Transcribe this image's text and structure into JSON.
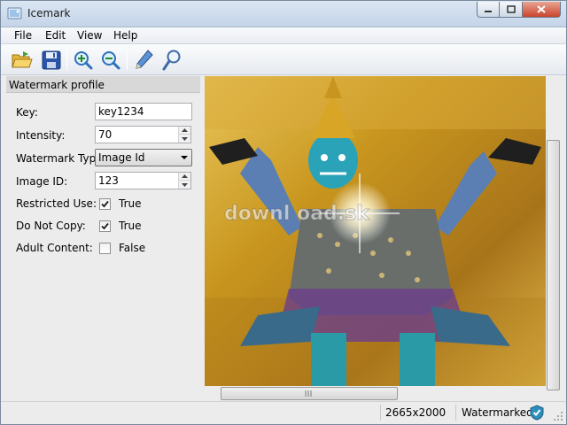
{
  "window": {
    "title": "Icemark"
  },
  "menu": [
    "File",
    "Edit",
    "View",
    "Help"
  ],
  "toolbar": {
    "open": "open-folder-icon",
    "save": "save-disk-icon",
    "zoom_in": "zoom-in-icon",
    "zoom_out": "zoom-out-icon",
    "pen": "pencil-icon",
    "detect": "magnifier-icon"
  },
  "panel": {
    "title": "Watermark profile",
    "key_label": "Key:",
    "key_value": "key1234",
    "intensity_label": "Intensity:",
    "intensity_value": "70",
    "type_label": "Watermark Type:",
    "type_value": "Image Id",
    "image_id_label": "Image ID:",
    "image_id_value": "123",
    "restricted_label": "Restricted Use:",
    "restricted_value": "True",
    "restricted_checked": true,
    "nocopy_label": "Do Not Copy:",
    "nocopy_value": "True",
    "nocopy_checked": true,
    "adult_label": "Adult Content:",
    "adult_value": "False",
    "adult_checked": false
  },
  "image": {
    "watermark_text": "downl oad.sk",
    "description": "golden temple guardian statue photo"
  },
  "status": {
    "dimensions": "2665x2000",
    "state": "Watermarked",
    "state_icon": "shield-check-icon"
  },
  "colors": {
    "accent": "#2c6fbd",
    "gold": "#c8961e",
    "teal": "#2aa3b8"
  }
}
